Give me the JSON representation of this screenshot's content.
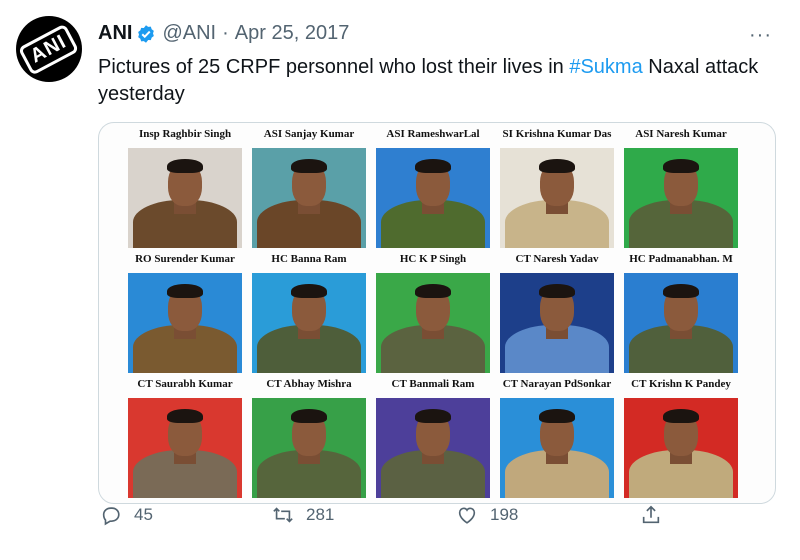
{
  "tweet": {
    "author_name": "ANI",
    "handle": "@ANI",
    "separator": "·",
    "date": "Apr 25, 2017",
    "avatar_text": "ANI",
    "more": "···",
    "text_before": "Pictures of 25 CRPF personnel who lost their lives in ",
    "hashtag": "#Sukma",
    "text_after": " Naxal attack yesterday"
  },
  "image": {
    "rows": [
      {
        "names": [
          "Insp Raghbir Singh",
          "ASI Sanjay Kumar",
          "ASI RameshwarLal",
          "SI Krishna Kumar Das",
          "ASI Naresh Kumar"
        ],
        "photos": [
          {
            "bg": "#d9d3cc",
            "uniform": "#6b4a2c"
          },
          {
            "bg": "#5aa0a8",
            "uniform": "#6a4628"
          },
          {
            "bg": "#2f7fd0",
            "uniform": "#4f6b2e"
          },
          {
            "bg": "#e6e1d6",
            "uniform": "#c8b48a"
          },
          {
            "bg": "#2faa4a",
            "uniform": "#55653a"
          }
        ]
      },
      {
        "names": [
          "RO Surender Kumar",
          "HC Banna Ram",
          "HC K P Singh",
          "CT Naresh Yadav",
          "HC Padmanabhan. M"
        ],
        "photos": [
          {
            "bg": "#2a8ad6",
            "uniform": "#7a5a30"
          },
          {
            "bg": "#2a9cd8",
            "uniform": "#4e5e3a"
          },
          {
            "bg": "#3aa848",
            "uniform": "#5b6340"
          },
          {
            "bg": "#1d3f8a",
            "uniform": "#5a88c8"
          },
          {
            "bg": "#2a7ed0",
            "uniform": "#50603c"
          }
        ]
      },
      {
        "names": [
          "CT Saurabh Kumar",
          "CT Abhay Mishra",
          "CT Banmali Ram",
          "CT Narayan PdSonkar",
          "CT Krishn K Pandey"
        ],
        "photos": [
          {
            "bg": "#d9382f",
            "uniform": "#7a6a56"
          },
          {
            "bg": "#37a048",
            "uniform": "#56653c"
          },
          {
            "bg": "#4d3f9a",
            "uniform": "#5b6143"
          },
          {
            "bg": "#2a8fd8",
            "uniform": "#c0a87c"
          },
          {
            "bg": "#d32a24",
            "uniform": "#c0aa7c"
          }
        ]
      }
    ]
  },
  "actions": {
    "reply_count": "45",
    "retweet_count": "281",
    "like_count": "198"
  },
  "colors": {
    "accent": "#1d9bf0",
    "secondary_text": "#536471",
    "border": "#cfd9de"
  },
  "icons": [
    "verified-badge-icon",
    "more-icon",
    "reply-icon",
    "retweet-icon",
    "like-icon",
    "share-icon"
  ]
}
